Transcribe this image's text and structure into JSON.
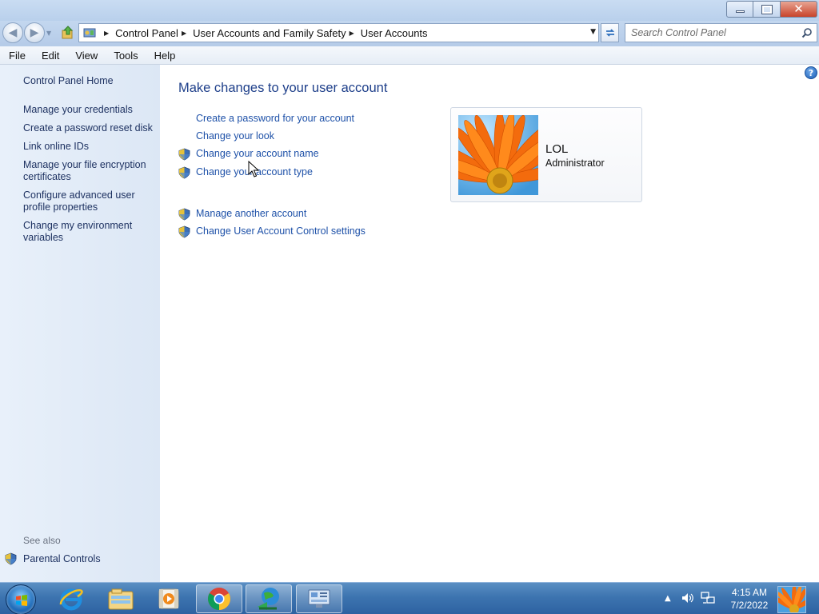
{
  "window": {
    "controls": {
      "minimize": "minimize",
      "maximize": "maximize",
      "close": "close"
    }
  },
  "nav": {
    "breadcrumbs": [
      "Control Panel",
      "User Accounts and Family Safety",
      "User Accounts"
    ],
    "search_placeholder": "Search Control Panel"
  },
  "menu": {
    "items": [
      "File",
      "Edit",
      "View",
      "Tools",
      "Help"
    ]
  },
  "sidebar": {
    "home": "Control Panel Home",
    "links": [
      "Manage your credentials",
      "Create a password reset disk",
      "Link online IDs",
      "Manage your file encryption certificates",
      "Configure advanced user profile properties",
      "Change my environment variables"
    ],
    "see_also_label": "See also",
    "see_also_links": [
      "Parental Controls"
    ]
  },
  "main": {
    "title": "Make changes to your user account",
    "tasks": [
      "Create a password for your account",
      "Change your look",
      "Change your account name",
      "Change your account type"
    ],
    "more_tasks": [
      "Manage another account",
      "Change User Account Control settings"
    ],
    "account": {
      "name": "LOL",
      "type": "Administrator"
    }
  },
  "taskbar": {
    "clock_time": "4:15 AM",
    "clock_date": "7/2/2022",
    "pinned": [
      "internet-explorer-icon",
      "windows-explorer-icon",
      "media-player-icon",
      "chrome-icon",
      "network-globe-icon",
      "control-panel-icon"
    ]
  },
  "colors": {
    "link": "#1e51a8",
    "title": "#1e3f8a",
    "sidebar_link": "#1b2f5f",
    "taskbar": "#3d74b0"
  }
}
